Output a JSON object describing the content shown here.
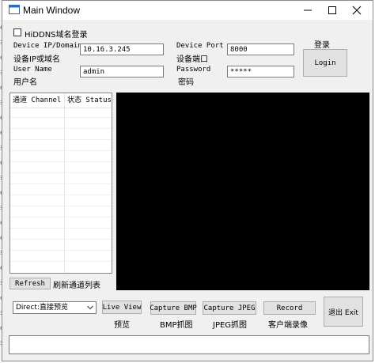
{
  "window": {
    "title": "Main Window"
  },
  "login": {
    "hiddns_label": "HiDDNS域名登录",
    "ip_label_en": "Device IP/Domain",
    "ip_label_cn": "设备IP或域名",
    "ip_value": "10.16.3.245",
    "port_label_en": "Device Port",
    "port_label_cn": "设备端口",
    "port_value": "8000",
    "user_label_en": "User Name",
    "user_label_cn": "用户名",
    "user_value": "admin",
    "password_label_en": "Password",
    "password_label_cn": "密码",
    "password_value": "*****",
    "login_caption": "登录",
    "login_button": "Login"
  },
  "channel_list": {
    "col_channel": "通道 Channel",
    "col_status": "状态 Status",
    "refresh_button": "Refresh",
    "refresh_caption": "刷新通道列表"
  },
  "controls": {
    "mode_selected": "Direct:直接预览",
    "live_view_button": "Live View",
    "live_view_caption": "预览",
    "capture_bmp_button": "Capture BMP",
    "capture_bmp_caption": "BMP抓图",
    "capture_jpeg_button": "Capture JPEG",
    "capture_jpeg_caption": "JPEG抓图",
    "record_button": "Record",
    "record_caption": "客户端录像",
    "exit_button": "退出 Exit"
  },
  "background_window_glyphs": [
    "e",
    "毛",
    "e",
    "毛",
    "e",
    "毛",
    "e",
    "e",
    "毛",
    "e",
    "毛",
    "e",
    "毛",
    "e",
    "e",
    "毛",
    "e",
    "毛",
    "e",
    "毛",
    "e",
    "毛"
  ]
}
